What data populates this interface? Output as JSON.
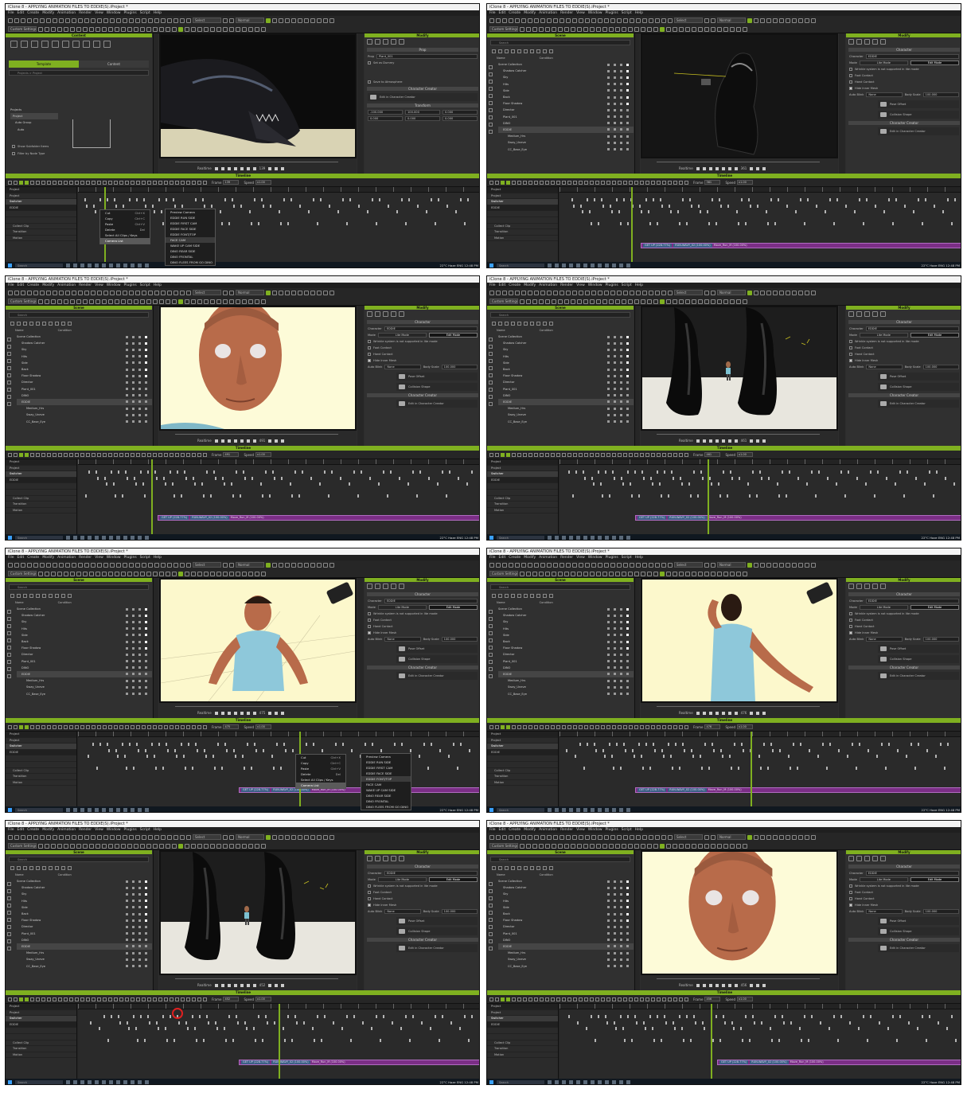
{
  "app": {
    "title": "iClone 8 - APPLYING ANIMATION FILES TO EDDIE(S).iProject *",
    "menu": [
      "File",
      "Edit",
      "Create",
      "Modify",
      "Animation",
      "Render",
      "View",
      "Window",
      "Plugins",
      "Script",
      "Help"
    ],
    "toolbar_preset": "Custom Settings",
    "toolbar_select": "Select",
    "toolbar_normal": "Normal"
  },
  "panels": {
    "content_title": "Content",
    "scene_title": "Scene",
    "modify_title": "Modify",
    "timeline_title": "Timeline",
    "search_placeholder": "Search"
  },
  "content_panel": {
    "tab_template": "Template",
    "tab_custom": "Content",
    "project_path": "Projects > Project",
    "tree_items": [
      "Projects",
      "Project",
      "Auto Group",
      "Auto"
    ],
    "checkbox_1": "Show Subfolder Items",
    "checkbox_2": "Filter by Node Type"
  },
  "scene_tree": {
    "columns": [
      "Name",
      "Condition"
    ],
    "items": [
      "Scene Collection",
      "Shadow Catcher",
      "Sky",
      "Hits",
      "Side",
      "Back",
      "Floor Shadow",
      "Director",
      "Plant_001",
      "DINO",
      "EDDIE",
      "Medium_Hrs",
      "Sway_Uneve",
      "CC_Base_Eye"
    ]
  },
  "modify_panel": {
    "prop_title": "Prop",
    "prop_name_label": "Prop",
    "prop_name": "Plant_001",
    "set_as_dummy": "Set as Dummy",
    "save_atmosphere": "Save to Atmosphere",
    "character_creator_title": "Character Creator",
    "edit_in_cc": "Edit in Character Creator",
    "transform_title": "Transform",
    "character_title": "Character",
    "character_label": "Character",
    "character_name": "EDDIE",
    "mode_label": "Mode",
    "lite_mode": "Lite Mode",
    "edit_mode": "Edit Mode",
    "warning": "Wrinkle system is not supported in lite mode",
    "foot_contact": "Foot Contact",
    "hand_contact": "Hand Contact",
    "hide_inner_mesh": "Hide Inner Mesh",
    "auto_blink": "Auto Blink",
    "auto_blink_value": "None",
    "body_scale": "Body Scale",
    "body_scale_value": "100.000",
    "pose_offset": "Pose Offset",
    "collision_shape": "Collision Shape",
    "pos_x": "-100.000",
    "pos_y": "100.000",
    "pos_z": "0.000"
  },
  "playback": {
    "mode": "Realtime",
    "frames": [
      "139",
      "361",
      "491",
      "461",
      "475",
      "476",
      "452",
      "456"
    ]
  },
  "timeline": {
    "frame_label": "Frame",
    "speed_label": "Speed",
    "speed_value": "x1.00",
    "tracks": [
      "Project",
      "Project",
      "Switcher",
      "EDDIE",
      "Collect Clip",
      "Transition",
      "Motion"
    ],
    "clip_segments": [
      "GET UP (228.77%)",
      "RUN-WAVY_02 (100.00%)",
      "Move_Run_M (100.00%)"
    ]
  },
  "context_menu": {
    "edit_items": [
      "Cut",
      "Copy",
      "Paste",
      "Delete",
      "Select All Clips / Keys",
      "Camera List"
    ],
    "shortcuts": [
      "Ctrl+X",
      "Ctrl+C",
      "Ctrl+V",
      "Del"
    ],
    "camera_items": [
      "Preview Camera",
      "EDDIE RUN SIDE",
      "EDDIE FIRST CAM",
      "EDDIE FACE SIDE",
      "EDDIE FONT/TOP",
      "FACE CAM",
      "WAKE UP CAM SIDE",
      "DINO REAR SIDE",
      "DINO FRONTAL",
      "DINO FLEES FROM GO DINO"
    ]
  },
  "taskbar": {
    "search": "Search",
    "weather": "22°C Haze",
    "lang": "ENG",
    "time": "12:48 PM"
  }
}
